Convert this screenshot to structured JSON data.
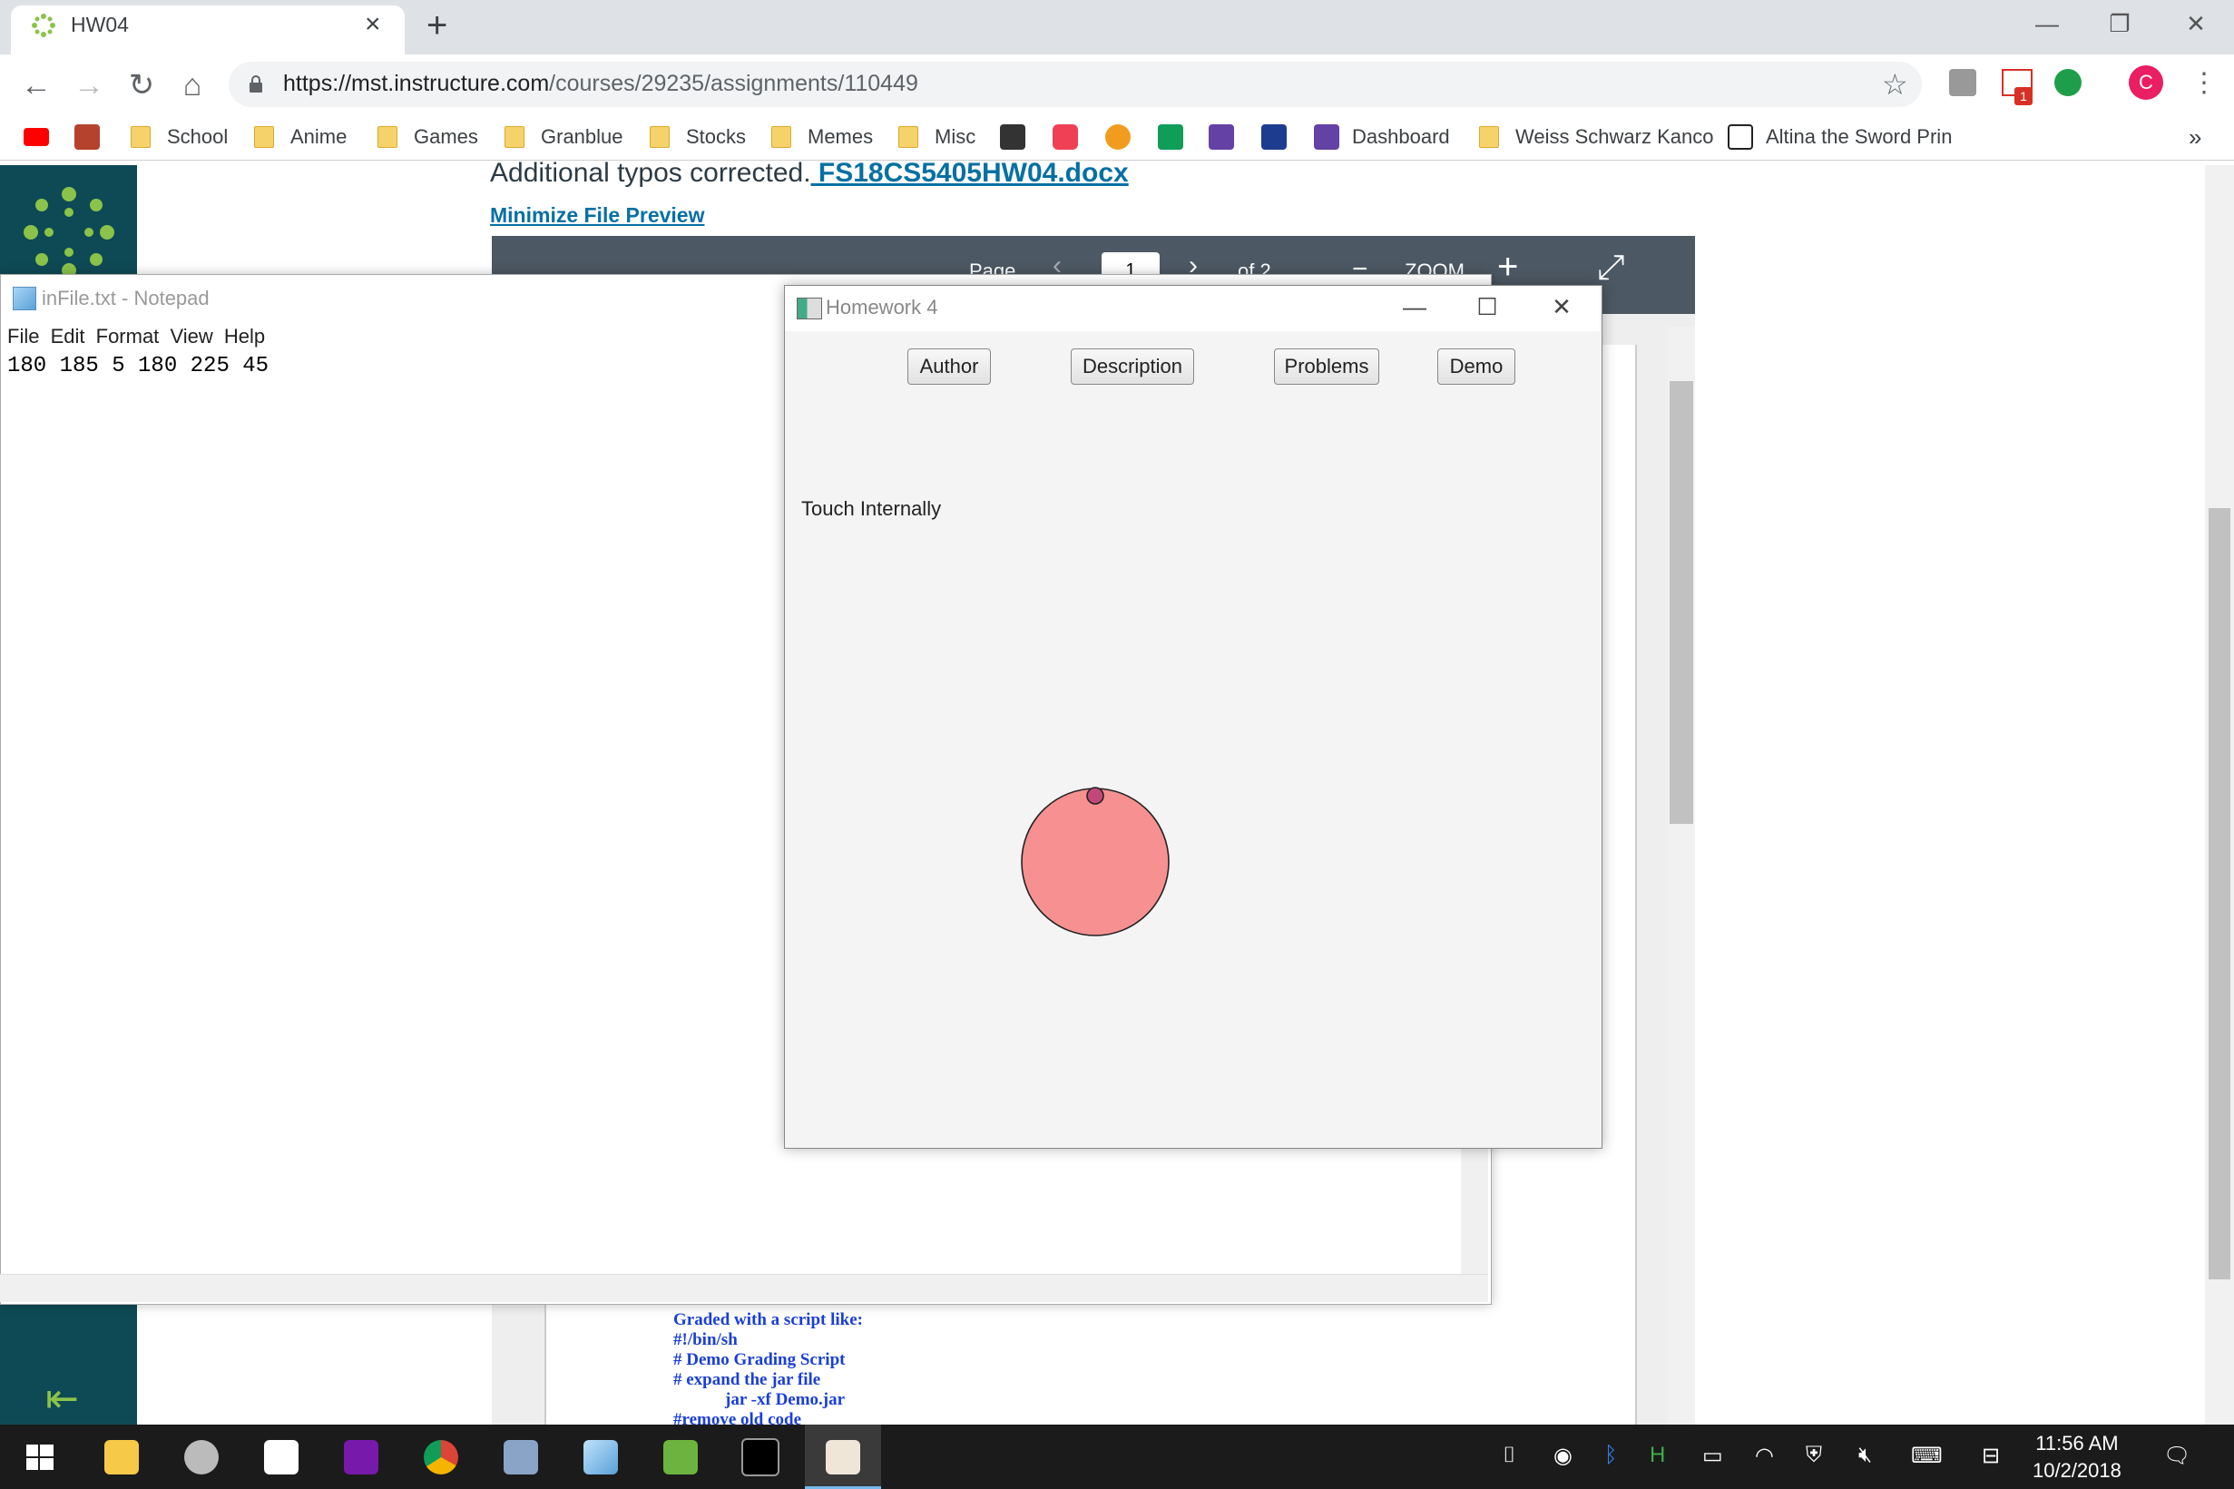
{
  "browser": {
    "tab_title": "HW04",
    "tab_close": "×",
    "new_tab": "+",
    "url_host": "https://mst.instructure.com",
    "url_path": "/courses/29235/assignments/110449",
    "bookmarks": [
      "School",
      "Anime",
      "Games",
      "Granblue",
      "Stocks",
      "Memes",
      "Misc",
      "Dashboard",
      "Weiss Schwarz Kanco",
      "Altina the Sword Prin"
    ],
    "bookmarks_more": "»",
    "gmail_badge": "1",
    "profile_initial": "C"
  },
  "canvas": {
    "typos_text": "Additional typos corrected.",
    "file_link": " FS18CS5405HW04.docx",
    "minimize_link": "Minimize File Preview",
    "viewer": {
      "page_label": "Page",
      "page_value": "1",
      "of_label": "of 2",
      "zoom_label": "ZOOM"
    },
    "doc_text": "Graded with a script like:\n#!/bin/sh\n# Demo Grading Script\n# expand the jar file\n            jar -xf Demo.jar\n#remove old code"
  },
  "notepad": {
    "title": "inFile.txt - Notepad",
    "menu": [
      "File",
      "Edit",
      "Format",
      "View",
      "Help"
    ],
    "content": "180 185 5 180 225 45"
  },
  "homework": {
    "title": "Homework 4",
    "buttons": [
      "Author",
      "Description",
      "Problems",
      "Demo"
    ],
    "status_label": "Touch Internally",
    "large_circle_fill": "#f79191",
    "small_circle_fill": "#c2487a"
  },
  "taskbar": {
    "time": "11:56 AM",
    "date": "10/2/2018"
  }
}
